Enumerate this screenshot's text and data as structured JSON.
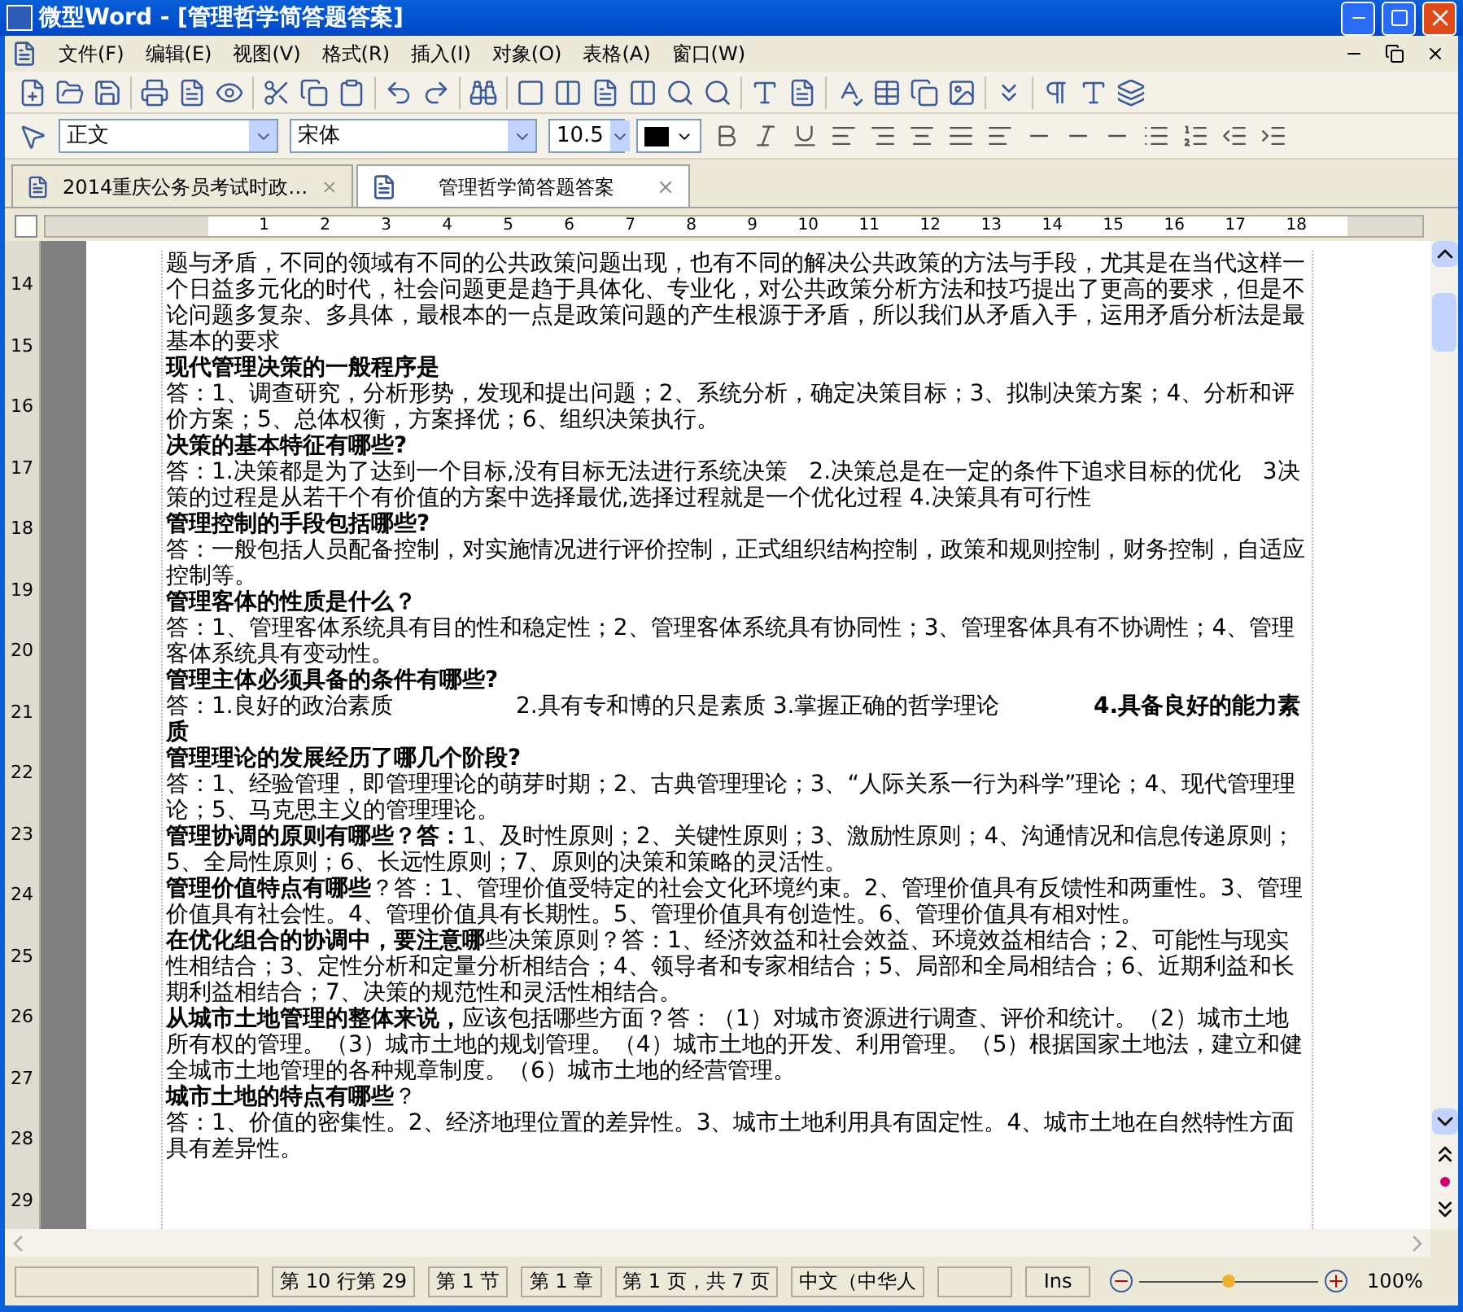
{
  "window": {
    "title": "微型Word - [管理哲学简答题答案]"
  },
  "menu": [
    "文件(F)",
    "编辑(E)",
    "视图(V)",
    "格式(R)",
    "插入(I)",
    "对象(O)",
    "表格(A)",
    "窗口(W)"
  ],
  "format_bar": {
    "style": "正文",
    "font": "宋体",
    "size": "10.5"
  },
  "tabs": [
    {
      "label": "2014重庆公务员考试时政…",
      "selected": false
    },
    {
      "label": "管理哲学简答题答案",
      "selected": true
    }
  ],
  "ruler": {
    "ticks": [
      "1",
      "2",
      "3",
      "4",
      "5",
      "6",
      "7",
      "8",
      "9",
      "10",
      "11",
      "12",
      "13",
      "14",
      "15",
      "16",
      "17",
      "18"
    ]
  },
  "line_numbers": [
    "14",
    "15",
    "16",
    "17",
    "18",
    "19",
    "20",
    "21",
    "22",
    "23",
    "24",
    "25",
    "26",
    "27",
    "28",
    "29"
  ],
  "document": {
    "paragraphs": [
      {
        "kind": "answer",
        "text": "题与矛盾，不同的领域有不同的公共政策问题出现，也有不同的解决公共政策的方法与手段，尤其是在当代这样一个日益多元化的时代，社会问题更是趋于具体化、专业化，对公共政策分析方法和技巧提出了更高的要求，但是不论问题多复杂、多具体，最根本的一点是政策问题的产生根源于矛盾，所以我们从矛盾入手，运用矛盾分析法是最基本的要求"
      },
      {
        "kind": "question",
        "text": "现代管理决策的一般程序是"
      },
      {
        "kind": "answer",
        "text": "答：1、调查研究，分析形势，发现和提出问题；2、系统分析，确定决策目标；3、拟制决策方案；4、分析和评价方案；5、总体权衡，方案择优；6、组织决策执行。"
      },
      {
        "kind": "question",
        "text": "决策的基本特征有哪些?"
      },
      {
        "kind": "answer",
        "text": "答：1.决策都是为了达到一个目标,没有目标无法进行系统决策   2.决策总是在一定的条件下追求目标的优化   3决策的过程是从若干个有价值的方案中选择最优,选择过程就是一个优化过程 4.决策具有可行性"
      },
      {
        "kind": "question",
        "text": "管理控制的手段包括哪些?"
      },
      {
        "kind": "answer",
        "text": "答：一般包括人员配备控制，对实施情况进行评价控制，正式组织结构控制，政策和规则控制，财务控制，自适应控制等。"
      },
      {
        "kind": "question",
        "text": "管理客体的性质是什么？"
      },
      {
        "kind": "answer",
        "text": "答：1、管理客体系统具有目的性和稳定性；2、管理客体系统具有协同性；3、管理客体具有不协调性；4、管理客体系统具有变动性。"
      },
      {
        "kind": "question",
        "text": "管理主体必须具备的条件有哪些?"
      },
      {
        "kind": "answer",
        "text": "答：1.良好的政治素质                 2.具有专和博的只是素质 3.掌握正确的哲学理论             **4.具备良好的能力素质**"
      },
      {
        "kind": "question",
        "text": "管理理论的发展经历了哪几个阶段?"
      },
      {
        "kind": "answer",
        "text": "答：1、经验管理，即管理理论的萌芽时期；2、古典管理理论；3、“人际关系一行为科学”理论；4、现代管理理论；5、马克思主义的管理理论。"
      },
      {
        "kind": "answer",
        "text": "**管理协调的原则有哪些？答：**1、及时性原则；2、关键性原则；3、激励性原则；4、沟通情况和信息传递原则；5、全局性原则；6、长远性原则；7、原则的决策和策略的灵活性。"
      },
      {
        "kind": "answer",
        "text": "**管理价值特点有哪些**？答：1、管理价值受特定的社会文化环境约束。2、管理价值具有反馈性和两重性。3、管理价值具有社会性。4、管理价值具有长期性。5、管理价值具有创造性。6、管理价值具有相对性。"
      },
      {
        "kind": "answer",
        "text": "**在优化组合的协调中，要注意哪**些决策原则？答：1、经济效益和社会效益、环境效益相结合；2、可能性与现实性相结合；3、定性分析和定量分析相结合；4、领导者和专家相结合；5、局部和全局相结合；6、近期利益和长期利益相结合；7、决策的规范性和灵活性相结合。"
      },
      {
        "kind": "answer",
        "text": "**从城市土地管理的整体来说，**应该包括哪些方面？答：（1）对城市资源进行调查、评价和统计。（2）城市土地所有权的管理。（3）城市土地的规划管理。（4）城市土地的开发、利用管理。（5）根据国家土地法，建立和健全城市土地管理的各种规章制度。（6）城市土地的经营管理。"
      },
      {
        "kind": "answer",
        "text": "**城市土地的特点有哪些**？"
      },
      {
        "kind": "answer",
        "text": "答：1、价值的密集性。2、经济地理位置的差异性。3、城市土地利用具有固定性。4、城市土地在自然特性方面具有差异性。"
      }
    ]
  },
  "status_bar": {
    "fields": [
      "第 10 行第 29",
      "第 1 节",
      "第 1 章",
      "第 1 页，共 7 页",
      "中文（中华人",
      "Ins"
    ],
    "zoom": {
      "level": 0.5,
      "reading": "100%"
    }
  }
}
